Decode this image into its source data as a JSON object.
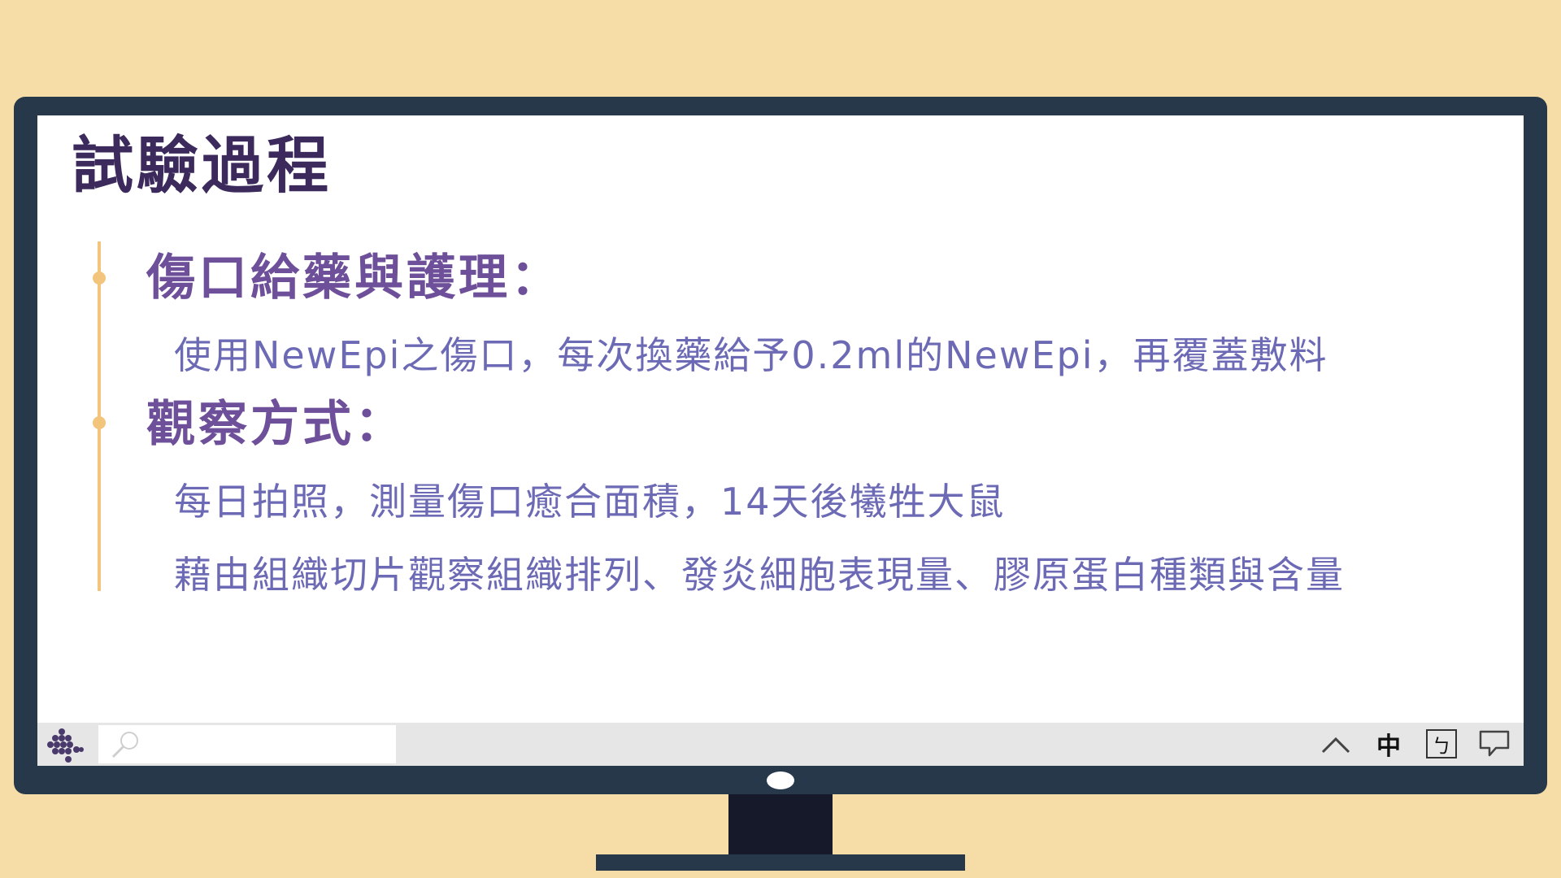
{
  "slide": {
    "title": "試驗過程",
    "sections": [
      {
        "heading": "傷口給藥與護理：",
        "lines": [
          "使用NewEpi之傷口，每次換藥給予0.2ml的NewEpi，再覆蓋敷料"
        ]
      },
      {
        "heading": "觀察方式：",
        "lines": [
          "每日拍照，測量傷口癒合面積，14天後犧牲大鼠",
          "藉由組織切片觀察組織排列、發炎細胞表現量、膠原蛋白種類與含量"
        ]
      }
    ]
  },
  "taskbar": {
    "start_icon": "cluster-logo-icon",
    "search_icon": "search-icon",
    "tray": {
      "chevron_icon": "chevron-up-icon",
      "language": "中",
      "ime": "ㄅ",
      "notification_icon": "notification-icon"
    }
  },
  "colors": {
    "background": "#f6dca7",
    "bezel": "#263849",
    "title": "#3c2a5c",
    "heading": "#6e4f99",
    "body_text": "#6d6ab5",
    "timeline": "#f3c57c",
    "taskbar": "#e6e6e6",
    "logo": "#4a3a6b"
  }
}
